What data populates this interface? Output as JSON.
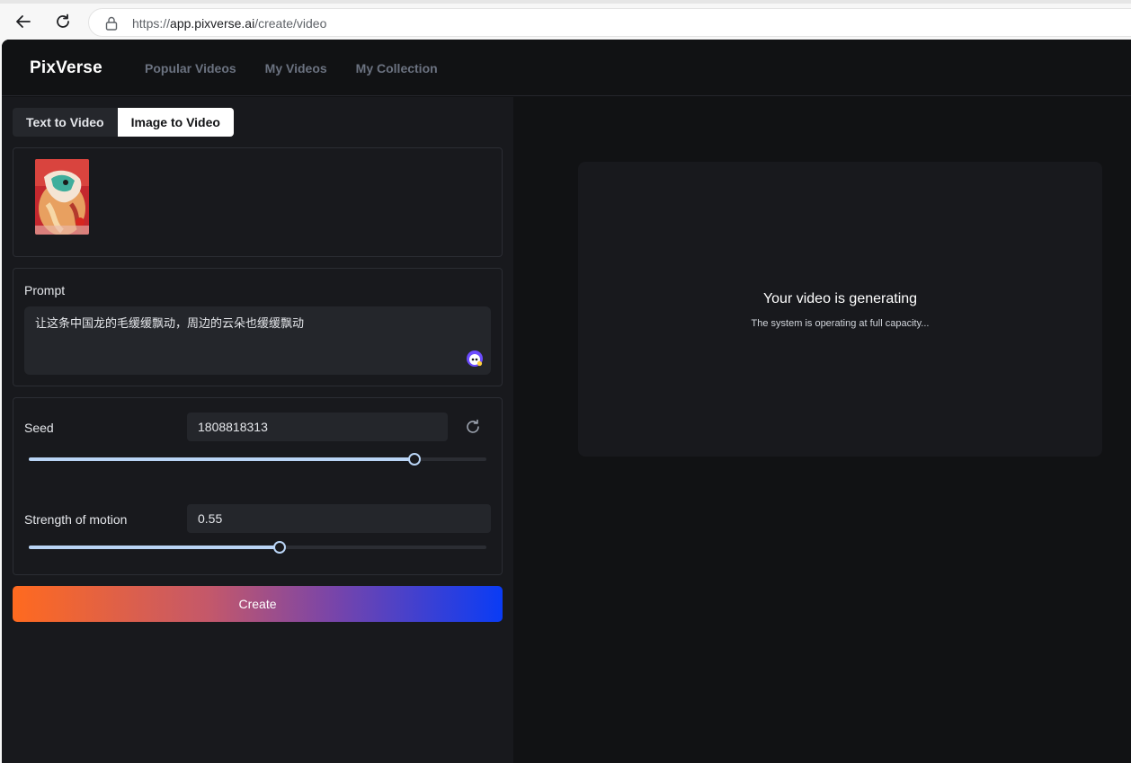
{
  "browser": {
    "url_prefix": "https://",
    "url_host": "app.pixverse.ai",
    "url_path": "/create/video"
  },
  "app": {
    "logo": "PixVerse",
    "nav": [
      "Popular Videos",
      "My Videos",
      "My Collection"
    ]
  },
  "tabs": {
    "text_to_video": "Text to Video",
    "image_to_video": "Image to Video",
    "active": "Image to Video"
  },
  "prompt": {
    "label": "Prompt",
    "value": "让这条中国龙的毛缓缓飘动，周边的云朵也缓缓飘动"
  },
  "seed": {
    "label": "Seed",
    "value": "1808818313",
    "slider_fraction": 0.843
  },
  "motion": {
    "label": "Strength of motion",
    "value": "0.55",
    "slider_fraction": 0.548
  },
  "create_label": "Create",
  "status": {
    "title": "Your video is generating",
    "subtitle": "The system is operating at full capacity..."
  },
  "colors": {
    "accent_slider": "#b9d4f5",
    "gradient_start": "#ff6a1f",
    "gradient_end": "#0a3cf5"
  }
}
